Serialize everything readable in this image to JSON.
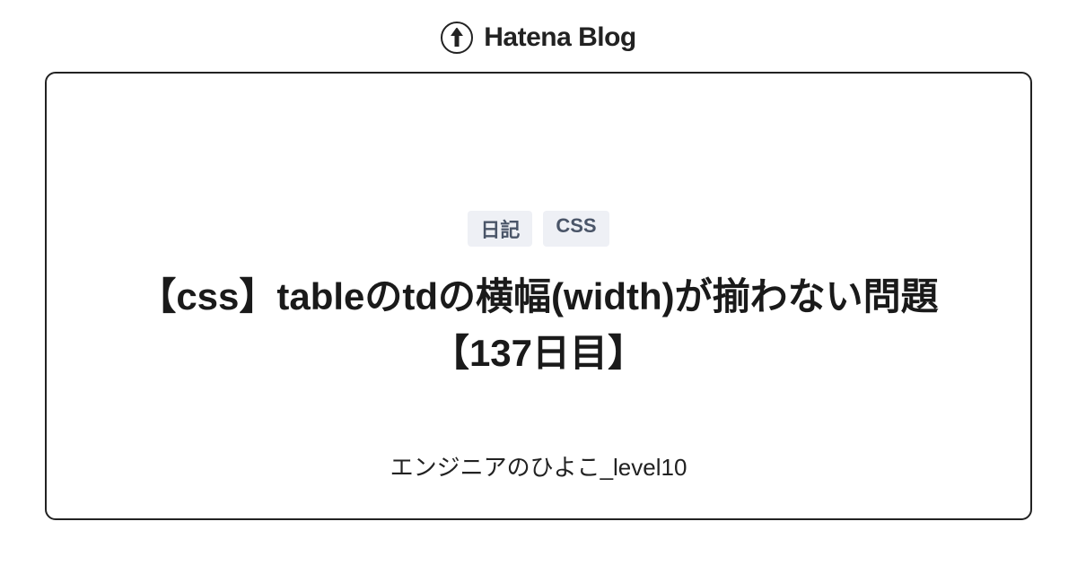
{
  "header": {
    "brand": "Hatena Blog"
  },
  "card": {
    "tags": [
      "日記",
      "CSS"
    ],
    "title": "【css】tableのtdの横幅(width)が揃わない問題【137日目】",
    "author": "エンジニアのひよこ_level10"
  }
}
